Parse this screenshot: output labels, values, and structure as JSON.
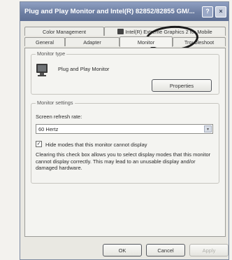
{
  "dialog": {
    "title": "Plug and Play Monitor and Intel(R) 82852/82855 GM/...",
    "help_label": "?",
    "close_label": "×"
  },
  "tabs_row1": [
    {
      "label": "Color Management"
    },
    {
      "label": "Intel(R) Extreme Graphics 2 for Mobile"
    }
  ],
  "tabs_row2": [
    {
      "label": "General"
    },
    {
      "label": "Adapter"
    },
    {
      "label": "Monitor",
      "active": true
    },
    {
      "label": "Troubleshoot"
    }
  ],
  "monitor_type": {
    "legend": "Monitor type",
    "name": "Plug and Play Monitor",
    "properties_label": "Properties",
    "icon": "monitor-icon"
  },
  "monitor_settings": {
    "legend": "Monitor settings",
    "refresh_label": "Screen refresh rate:",
    "refresh_value": "60 Hertz",
    "hide_modes_label": "Hide modes that this monitor cannot display",
    "hide_modes_checked": true,
    "description": "Clearing this check box allows you to select display modes that this monitor cannot display correctly. This may lead to an unusable display and/or damaged hardware."
  },
  "footer": {
    "ok_label": "OK",
    "cancel_label": "Cancel",
    "apply_label": "Apply"
  },
  "colors": {
    "titlebar": "#6e7fa3",
    "dialog_bg": "#e9e8e2",
    "panel_bg": "#f4f4f1"
  }
}
